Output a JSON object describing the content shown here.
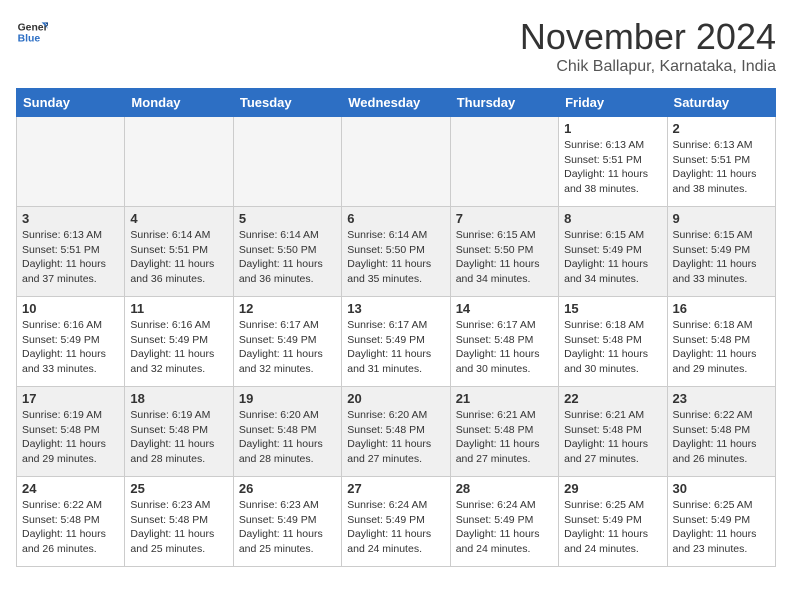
{
  "logo": {
    "general": "General",
    "blue": "Blue"
  },
  "header": {
    "month": "November 2024",
    "location": "Chik Ballapur, Karnataka, India"
  },
  "weekdays": [
    "Sunday",
    "Monday",
    "Tuesday",
    "Wednesday",
    "Thursday",
    "Friday",
    "Saturday"
  ],
  "weeks": [
    [
      {
        "day": "",
        "text": ""
      },
      {
        "day": "",
        "text": ""
      },
      {
        "day": "",
        "text": ""
      },
      {
        "day": "",
        "text": ""
      },
      {
        "day": "",
        "text": ""
      },
      {
        "day": "1",
        "text": "Sunrise: 6:13 AM\nSunset: 5:51 PM\nDaylight: 11 hours\nand 38 minutes."
      },
      {
        "day": "2",
        "text": "Sunrise: 6:13 AM\nSunset: 5:51 PM\nDaylight: 11 hours\nand 38 minutes."
      }
    ],
    [
      {
        "day": "3",
        "text": "Sunrise: 6:13 AM\nSunset: 5:51 PM\nDaylight: 11 hours\nand 37 minutes."
      },
      {
        "day": "4",
        "text": "Sunrise: 6:14 AM\nSunset: 5:51 PM\nDaylight: 11 hours\nand 36 minutes."
      },
      {
        "day": "5",
        "text": "Sunrise: 6:14 AM\nSunset: 5:50 PM\nDaylight: 11 hours\nand 36 minutes."
      },
      {
        "day": "6",
        "text": "Sunrise: 6:14 AM\nSunset: 5:50 PM\nDaylight: 11 hours\nand 35 minutes."
      },
      {
        "day": "7",
        "text": "Sunrise: 6:15 AM\nSunset: 5:50 PM\nDaylight: 11 hours\nand 34 minutes."
      },
      {
        "day": "8",
        "text": "Sunrise: 6:15 AM\nSunset: 5:49 PM\nDaylight: 11 hours\nand 34 minutes."
      },
      {
        "day": "9",
        "text": "Sunrise: 6:15 AM\nSunset: 5:49 PM\nDaylight: 11 hours\nand 33 minutes."
      }
    ],
    [
      {
        "day": "10",
        "text": "Sunrise: 6:16 AM\nSunset: 5:49 PM\nDaylight: 11 hours\nand 33 minutes."
      },
      {
        "day": "11",
        "text": "Sunrise: 6:16 AM\nSunset: 5:49 PM\nDaylight: 11 hours\nand 32 minutes."
      },
      {
        "day": "12",
        "text": "Sunrise: 6:17 AM\nSunset: 5:49 PM\nDaylight: 11 hours\nand 32 minutes."
      },
      {
        "day": "13",
        "text": "Sunrise: 6:17 AM\nSunset: 5:49 PM\nDaylight: 11 hours\nand 31 minutes."
      },
      {
        "day": "14",
        "text": "Sunrise: 6:17 AM\nSunset: 5:48 PM\nDaylight: 11 hours\nand 30 minutes."
      },
      {
        "day": "15",
        "text": "Sunrise: 6:18 AM\nSunset: 5:48 PM\nDaylight: 11 hours\nand 30 minutes."
      },
      {
        "day": "16",
        "text": "Sunrise: 6:18 AM\nSunset: 5:48 PM\nDaylight: 11 hours\nand 29 minutes."
      }
    ],
    [
      {
        "day": "17",
        "text": "Sunrise: 6:19 AM\nSunset: 5:48 PM\nDaylight: 11 hours\nand 29 minutes."
      },
      {
        "day": "18",
        "text": "Sunrise: 6:19 AM\nSunset: 5:48 PM\nDaylight: 11 hours\nand 28 minutes."
      },
      {
        "day": "19",
        "text": "Sunrise: 6:20 AM\nSunset: 5:48 PM\nDaylight: 11 hours\nand 28 minutes."
      },
      {
        "day": "20",
        "text": "Sunrise: 6:20 AM\nSunset: 5:48 PM\nDaylight: 11 hours\nand 27 minutes."
      },
      {
        "day": "21",
        "text": "Sunrise: 6:21 AM\nSunset: 5:48 PM\nDaylight: 11 hours\nand 27 minutes."
      },
      {
        "day": "22",
        "text": "Sunrise: 6:21 AM\nSunset: 5:48 PM\nDaylight: 11 hours\nand 27 minutes."
      },
      {
        "day": "23",
        "text": "Sunrise: 6:22 AM\nSunset: 5:48 PM\nDaylight: 11 hours\nand 26 minutes."
      }
    ],
    [
      {
        "day": "24",
        "text": "Sunrise: 6:22 AM\nSunset: 5:48 PM\nDaylight: 11 hours\nand 26 minutes."
      },
      {
        "day": "25",
        "text": "Sunrise: 6:23 AM\nSunset: 5:48 PM\nDaylight: 11 hours\nand 25 minutes."
      },
      {
        "day": "26",
        "text": "Sunrise: 6:23 AM\nSunset: 5:49 PM\nDaylight: 11 hours\nand 25 minutes."
      },
      {
        "day": "27",
        "text": "Sunrise: 6:24 AM\nSunset: 5:49 PM\nDaylight: 11 hours\nand 24 minutes."
      },
      {
        "day": "28",
        "text": "Sunrise: 6:24 AM\nSunset: 5:49 PM\nDaylight: 11 hours\nand 24 minutes."
      },
      {
        "day": "29",
        "text": "Sunrise: 6:25 AM\nSunset: 5:49 PM\nDaylight: 11 hours\nand 24 minutes."
      },
      {
        "day": "30",
        "text": "Sunrise: 6:25 AM\nSunset: 5:49 PM\nDaylight: 11 hours\nand 23 minutes."
      }
    ]
  ]
}
